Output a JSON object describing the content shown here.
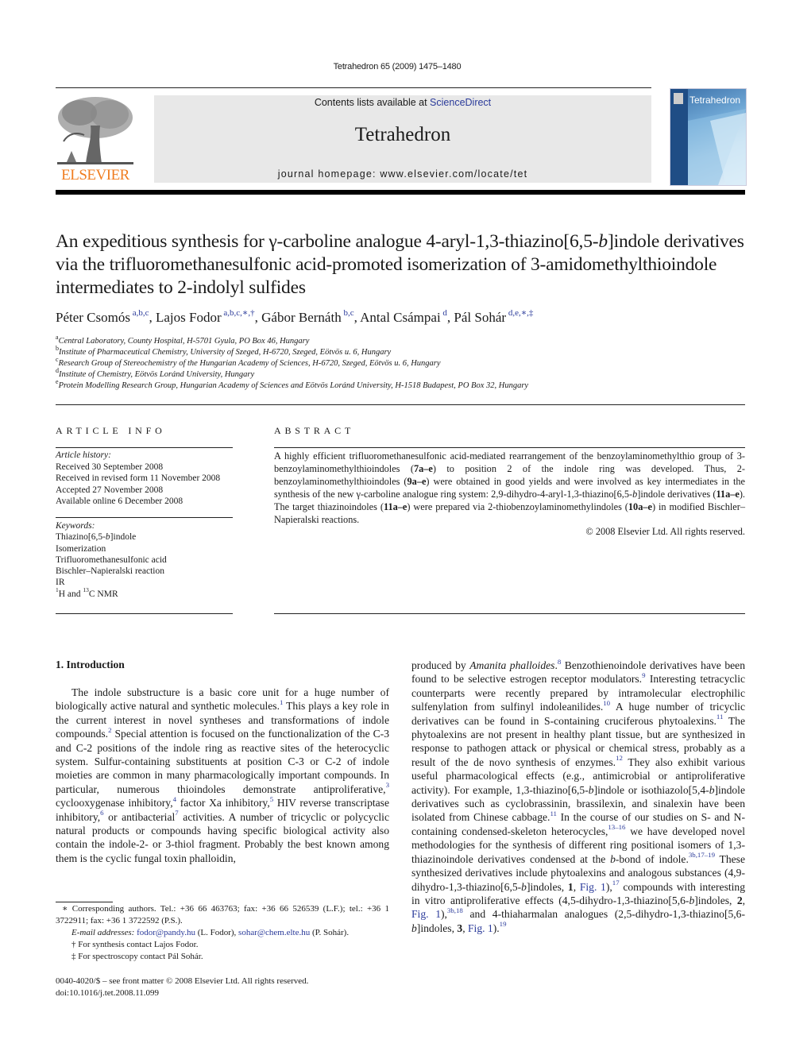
{
  "header": {
    "journal_ref": "Tetrahedron 65 (2009) 1475–1480",
    "contents_prefix": "Contents lists available at ",
    "contents_link": "ScienceDirect",
    "journal_name": "Tetrahedron",
    "homepage": "journal homepage: www.elsevier.com/locate/tet",
    "publisher_logo_text": "ELSEVIER",
    "cover_title": "Tetrahedron",
    "colors": {
      "publisher_orange": "#f07d20",
      "link_blue": "#2a3a9a",
      "banner_gray": "#e8e8e8"
    }
  },
  "article": {
    "title_part1": "An expeditious synthesis for γ-carboline analogue 4-aryl-1,3-thiazino[6,5-",
    "title_italic_b": "b",
    "title_part2": "]indole derivatives via the trifluoromethanesulfonic acid-promoted isomerization of 3-amidomethylthioindole intermediates to 2-indolyl sulfides",
    "authors": [
      {
        "name": "Péter Csomós",
        "sup": "a,b,c",
        "sep": ", "
      },
      {
        "name": "Lajos Fodor",
        "sup": "a,b,c,∗,†",
        "sep": ", "
      },
      {
        "name": "Gábor Bernáth",
        "sup": "b,c",
        "sep": ", "
      },
      {
        "name": "Antal Csámpai",
        "sup": "d",
        "sep": ", "
      },
      {
        "name": "Pál Sohár",
        "sup": "d,e,∗,‡",
        "sep": ""
      }
    ],
    "affiliations": [
      {
        "key": "a",
        "text": "Central Laboratory, County Hospital, H-5701 Gyula, PO Box 46, Hungary"
      },
      {
        "key": "b",
        "text": "Institute of Pharmaceutical Chemistry, University of Szeged, H-6720, Szeged, Eötvös u. 6, Hungary"
      },
      {
        "key": "c",
        "text": "Research Group of Stereochemistry of the Hungarian Academy of Sciences, H-6720, Szeged, Eötvös u. 6, Hungary"
      },
      {
        "key": "d",
        "text": "Institute of Chemistry, Eötvös Loránd University, Hungary"
      },
      {
        "key": "e",
        "text": "Protein Modelling Research Group, Hungarian Academy of Sciences and Eötvös Loránd University, H-1518 Budapest, PO Box 32, Hungary"
      }
    ]
  },
  "article_info": {
    "heading": "ARTICLE INFO",
    "history_label": "Article history:",
    "history": [
      "Received 30 September 2008",
      "Received in revised form 11 November 2008",
      "Accepted 27 November 2008",
      "Available online 6 December 2008"
    ],
    "keywords_label": "Keywords:",
    "keyword_1_pre": "Thiazino[6,5-",
    "keyword_1_ital": "b",
    "keyword_1_post": "]indole",
    "keywords_rest": [
      "Isomerization",
      "Trifluoromethanesulfonic acid",
      "Bischler–Napieralski reaction",
      "IR"
    ],
    "keyword_nmr": {
      "sup1": "1",
      "mid": "H and ",
      "sup2": "13",
      "end": "C NMR"
    }
  },
  "abstract": {
    "heading": "ABSTRACT",
    "segments": [
      {
        "t": "A highly efficient trifluoromethanesulfonic acid-mediated rearrangement of the benzoylaminomethylthio group of 3-benzoylaminomethylthioindoles ("
      },
      {
        "t": "7a–e",
        "b": true
      },
      {
        "t": ") to position 2 of the indole ring was developed. Thus, 2-benzoylaminomethylthioindoles ("
      },
      {
        "t": "9a–e",
        "b": true
      },
      {
        "t": ") were obtained in good yields and were involved as key intermediates in the synthesis of the new γ-carboline analogue ring system: 2,9-dihydro-4-aryl-1,3-thiazino[6,5-"
      },
      {
        "t": "b",
        "i": true
      },
      {
        "t": "]indole derivatives ("
      },
      {
        "t": "11a–e",
        "b": true
      },
      {
        "t": "). The target thiazinoindoles ("
      },
      {
        "t": "11a–e",
        "b": true
      },
      {
        "t": ") were prepared via 2-thiobenzoylaminomethylindoles ("
      },
      {
        "t": "10a–e",
        "b": true
      },
      {
        "t": ") in modified Bischler–Napieralski reactions."
      }
    ],
    "copyright": "© 2008 Elsevier Ltd. All rights reserved."
  },
  "introduction": {
    "heading": "1.  Introduction",
    "left_segments": [
      {
        "t": "The indole substructure is a basic core unit for a huge number of biologically active natural and synthetic molecules."
      },
      {
        "t": "1",
        "ref": true
      },
      {
        "t": " This plays a key role in the current interest in novel syntheses and transformations of indole compounds."
      },
      {
        "t": "2",
        "ref": true
      },
      {
        "t": " Special attention is focused on the functionalization of the C-3 and C-2 positions of the indole ring as reactive sites of the heterocyclic system. Sulfur-containing substituents at position C-3 or C-2 of indole moieties are common in many pharmacologically important compounds. In particular, numerous thioindoles demonstrate antiproliferative,"
      },
      {
        "t": "3",
        "ref": true
      },
      {
        "t": " cyclooxygenase inhibitory,"
      },
      {
        "t": "4",
        "ref": true
      },
      {
        "t": " factor Xa inhibitory,"
      },
      {
        "t": "5",
        "ref": true
      },
      {
        "t": " HIV reverse transcriptase inhibitory,"
      },
      {
        "t": "6",
        "ref": true
      },
      {
        "t": " or antibacterial"
      },
      {
        "t": "7",
        "ref": true
      },
      {
        "t": " activities. A number of tricyclic or polycyclic natural products or compounds having specific biological activity also contain the indole-2- or 3-thiol fragment. Probably the best known among them is the cyclic fungal toxin phalloidin,"
      }
    ],
    "right_segments": [
      {
        "t": "produced by "
      },
      {
        "t": "Amanita phalloides",
        "i": true
      },
      {
        "t": "."
      },
      {
        "t": "8",
        "ref": true
      },
      {
        "t": " Benzothienoindole derivatives have been found to be selective estrogen receptor modulators."
      },
      {
        "t": "9",
        "ref": true
      },
      {
        "t": " Interesting tetracyclic counterparts were recently prepared by intramolecular electrophilic sulfenylation from sulfinyl indoleanilides."
      },
      {
        "t": "10",
        "ref": true
      },
      {
        "t": " A huge number of tricyclic derivatives can be found in S-containing cruciferous phytoalexins."
      },
      {
        "t": "11",
        "ref": true
      },
      {
        "t": " The phytoalexins are not present in healthy plant tissue, but are synthesized in response to pathogen attack or physical or chemical stress, probably as a result of the de novo synthesis of enzymes."
      },
      {
        "t": "12",
        "ref": true
      },
      {
        "t": " They also exhibit various useful pharmacological effects (e.g., antimicrobial or antiproliferative activity). For example, 1,3-thiazino[6,5-"
      },
      {
        "t": "b",
        "i": true
      },
      {
        "t": "]indole or isothiazolo[5,4-"
      },
      {
        "t": "b",
        "i": true
      },
      {
        "t": "]indole derivatives such as cyclobrassinin, brassilexin, and sinalexin have been isolated from Chinese cabbage."
      },
      {
        "t": "11",
        "ref": true
      },
      {
        "t": " In the course of our studies on S- and N-containing condensed-skeleton heterocycles,"
      },
      {
        "t": "13–16",
        "ref": true
      },
      {
        "t": " we have developed novel methodologies for the synthesis of different ring positional isomers of 1,3-thiazinoindole derivatives condensed at the "
      },
      {
        "t": "b",
        "i": true
      },
      {
        "t": "-bond of indole."
      },
      {
        "t": "3b,17–19",
        "ref": true
      },
      {
        "t": " These synthesized derivatives include phytoalexins and analogous substances (4,9-dihydro-1,3-thiazino[6,5-"
      },
      {
        "t": "b",
        "i": true
      },
      {
        "t": "]indoles, "
      },
      {
        "t": "1",
        "b": true
      },
      {
        "t": ", "
      },
      {
        "t": "Fig. 1",
        "link": true
      },
      {
        "t": "),"
      },
      {
        "t": "17",
        "ref": true
      },
      {
        "t": " compounds with interesting in vitro antiproliferative effects (4,5-dihydro-1,3-thiazino[5,6-"
      },
      {
        "t": "b",
        "i": true
      },
      {
        "t": "]indoles, "
      },
      {
        "t": "2",
        "b": true
      },
      {
        "t": ", "
      },
      {
        "t": "Fig. 1",
        "link": true
      },
      {
        "t": "),"
      },
      {
        "t": "3b,18",
        "ref": true
      },
      {
        "t": " and 4-thiaharmalan analogues (2,5-dihydro-1,3-thiazino[5,6-"
      },
      {
        "t": "b",
        "i": true
      },
      {
        "t": "]indoles, "
      },
      {
        "t": "3",
        "b": true
      },
      {
        "t": ", "
      },
      {
        "t": "Fig. 1",
        "link": true
      },
      {
        "t": ")."
      },
      {
        "t": "19",
        "ref": true
      }
    ]
  },
  "footnotes": {
    "corresponding": "∗ Corresponding authors. Tel.: +36 66 463763; fax: +36 66 526539 (L.F.); tel.: +36 1 3722911; fax: +36 1 3722592 (P.S.).",
    "email_label": "E-mail addresses: ",
    "email_1": "fodor@pandy.hu",
    "email_1_who": " (L. Fodor), ",
    "email_2": "sohar@chem.elte.hu",
    "email_2_who": " (P. Sohár).",
    "dagger": "† For synthesis contact Lajos Fodor.",
    "ddagger": "‡ For spectroscopy contact Pál Sohár."
  },
  "front_matter": {
    "issn_line": "0040-4020/$ – see front matter © 2008 Elsevier Ltd. All rights reserved.",
    "doi": "doi:10.1016/j.tet.2008.11.099"
  }
}
